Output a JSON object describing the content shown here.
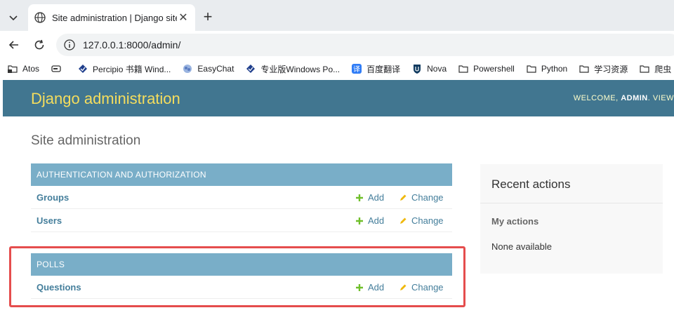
{
  "browser": {
    "tab_title": "Site administration | Django site a",
    "tab_close": "✕",
    "new_tab": "+",
    "url": "127.0.0.1:8000/admin/",
    "bookmarks": [
      {
        "label": "Atos",
        "icon": "lock-folder-icon"
      },
      {
        "label": "",
        "icon": "drive-icon"
      },
      {
        "label": "Percipio 书籍 Wind...",
        "icon": "diamond-icon"
      },
      {
        "label": "EasyChat",
        "icon": "brain-icon"
      },
      {
        "label": "专业版Windows Po...",
        "icon": "diamond-icon"
      },
      {
        "label": "百度翻译",
        "icon": "translate-icon"
      },
      {
        "label": "Nova",
        "icon": "shield-icon"
      },
      {
        "label": "Powershell",
        "icon": "folder-icon"
      },
      {
        "label": "Python",
        "icon": "folder-icon"
      },
      {
        "label": "学习资源",
        "icon": "folder-icon"
      },
      {
        "label": "爬虫",
        "icon": "folder-icon"
      }
    ]
  },
  "admin": {
    "brand": "Django administration",
    "welcome": "WELCOME, ",
    "user": "ADMIN",
    "after_user": ". VIEW",
    "page_title": "Site administration",
    "modules": [
      {
        "caption": "AUTHENTICATION AND AUTHORIZATION",
        "rows": [
          {
            "name": "Groups",
            "add": "Add",
            "change": "Change"
          },
          {
            "name": "Users",
            "add": "Add",
            "change": "Change"
          }
        ]
      },
      {
        "caption": "POLLS",
        "rows": [
          {
            "name": "Questions",
            "add": "Add",
            "change": "Change"
          }
        ]
      }
    ],
    "recent": {
      "title": "Recent actions",
      "subtitle": "My actions",
      "empty": "None available"
    }
  },
  "colors": {
    "header": "#417690",
    "brand": "#f5dd5d",
    "caption": "#79aec8",
    "link": "#447e9b",
    "add_icon": "#70bf2b",
    "change_icon": "#efb80b",
    "highlight": "#e54d4d"
  }
}
